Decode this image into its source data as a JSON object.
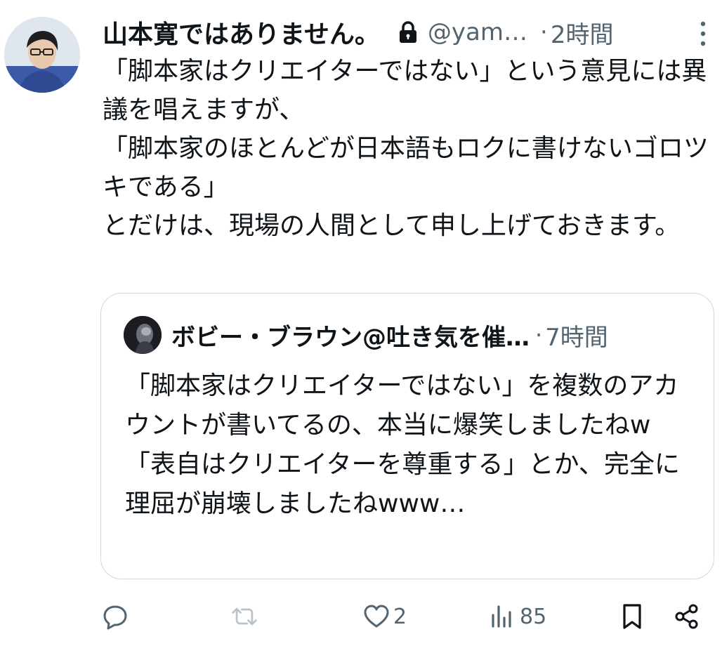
{
  "tweet": {
    "author_name": "山本寛ではありません。",
    "handle": "@yam…",
    "separator": "·",
    "time": "2時間",
    "text": "「脚本家はクリエイターではない」という意見には異議を唱えますが、\n「脚本家のほとんどが日本語もロクに書けないゴロツキである」\nとだけは、現場の人間として申し上げておきます。"
  },
  "quote": {
    "author_name": "ボビー・ブラウン@吐き気を催…",
    "separator": "·",
    "time": "7時間",
    "text": "「脚本家はクリエイターではない」を複数のアカウントが書いてるの、本当に爆笑しましたねw\n「表自はクリエイターを尊重する」とか、完全に理屈が崩壊しましたねwww…"
  },
  "actions": {
    "reply_count": "",
    "retweet_count": "",
    "like_count": "2",
    "views_count": "85"
  },
  "icons": [
    "avatar",
    "lock-icon",
    "more-icon",
    "reply-icon",
    "retweet-icon",
    "like-icon",
    "views-icon",
    "bookmark-icon",
    "share-icon"
  ],
  "colors": {
    "text": "#0f1419",
    "secondary": "#536471",
    "border": "#cfd9de"
  }
}
